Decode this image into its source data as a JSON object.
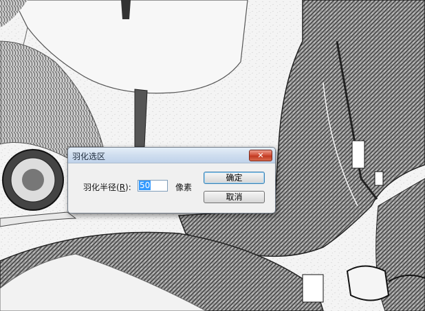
{
  "dialog": {
    "title": "羽化选区",
    "close_glyph": "✕",
    "feather_radius_label_prefix": "羽化半径(",
    "feather_radius_label_key": "R",
    "feather_radius_label_suffix": "):",
    "feather_radius_value": "50",
    "unit_label": "像素",
    "ok_label": "确定",
    "cancel_label": "取消"
  },
  "colors": {
    "titlebar": "#cfdeef",
    "close_button": "#c13a22",
    "selection_highlight": "#3399ff",
    "canvas_paper": "#f4f4f4",
    "sketch_ink": "#2b2b2b"
  }
}
